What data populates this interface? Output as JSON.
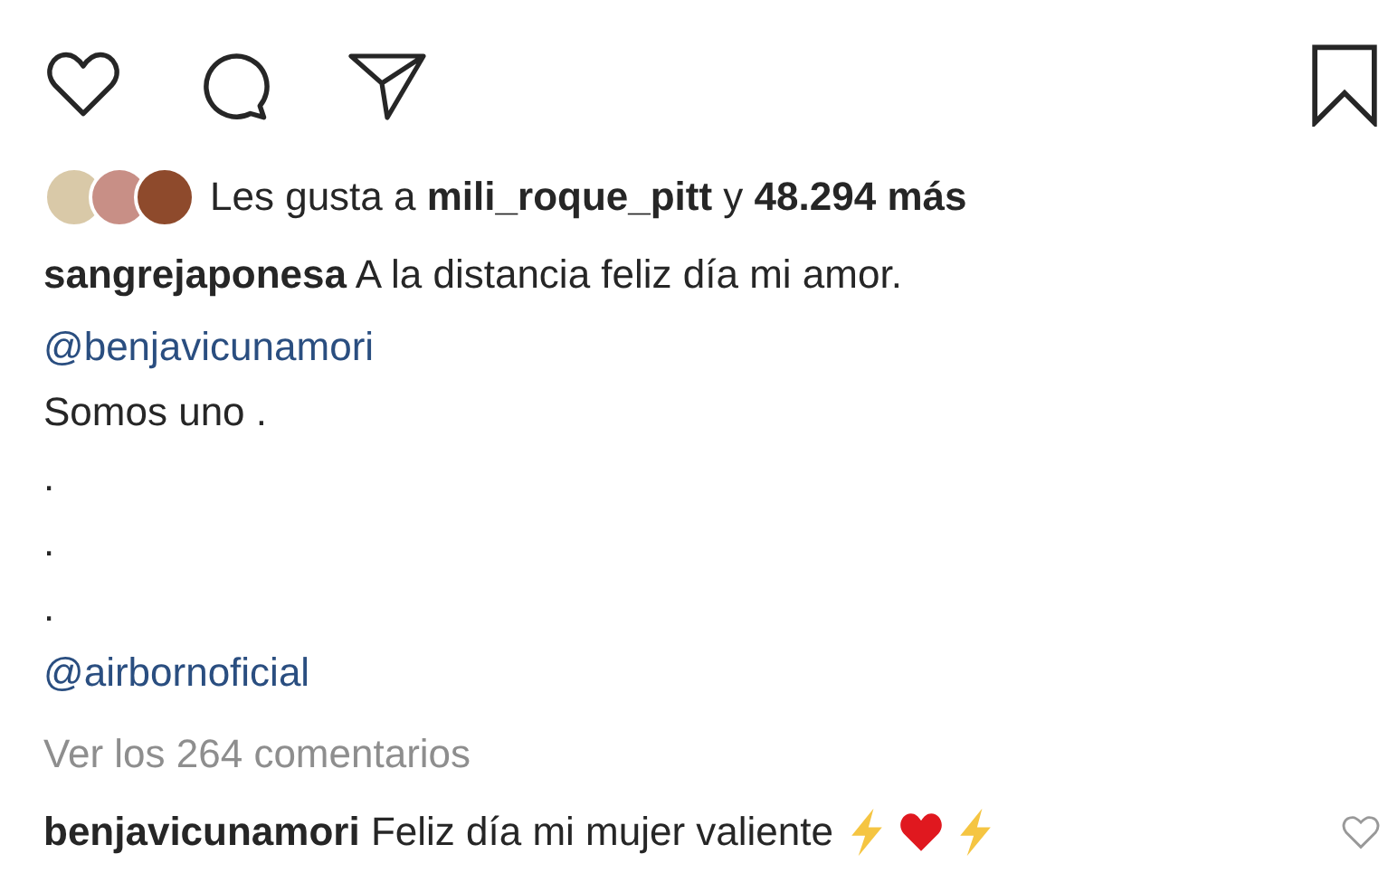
{
  "likes": {
    "text": "Les gusta a **mili_roque_pitt** y **48.294 más**"
  },
  "caption": {
    "text": "**sangrejaponesa** A la distancia feliz día mi amor.",
    "lines": [
      {
        "kind": "mention",
        "text": "@benjavicunamori"
      },
      {
        "kind": "text",
        "text": "Somos uno ."
      },
      {
        "kind": "text",
        "text": "."
      },
      {
        "kind": "text",
        "text": "."
      },
      {
        "kind": "text",
        "text": "."
      },
      {
        "kind": "mention",
        "text": "@airbornoficial"
      }
    ]
  },
  "view_comments": "Ver los 264 comentarios",
  "comment": {
    "text": "**benjavicunamori** Feliz día mi mujer valiente"
  }
}
